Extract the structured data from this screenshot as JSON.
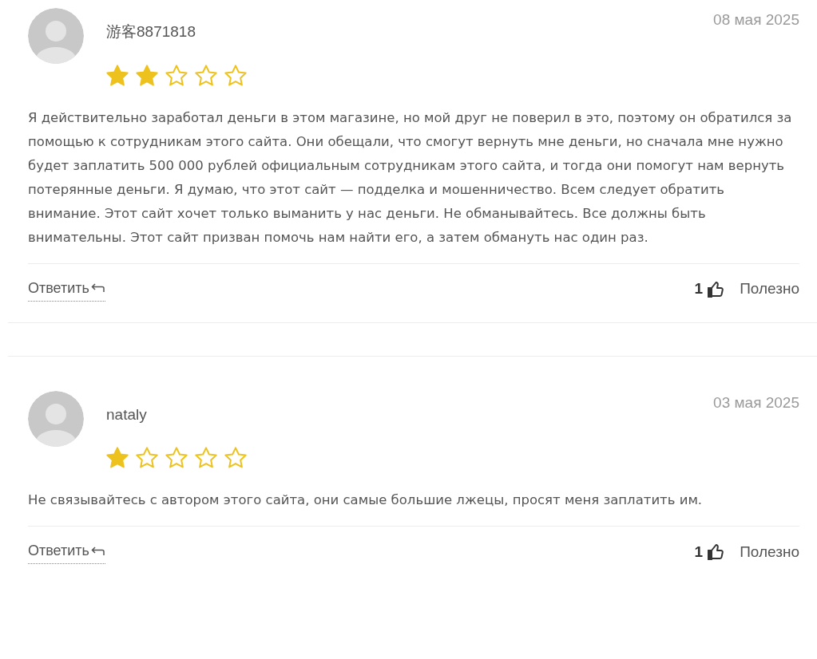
{
  "reviews": [
    {
      "author": "游客8871818",
      "date": "08 мая 2025",
      "stars": 2,
      "text": "Я действительно заработал деньги в этом магазине, но мой друг не поверил в это, поэтому он обратился за помощью к сотрудникам этого сайта. Они обещали, что смогут вернуть мне деньги, но сначала мне нужно будет заплатить 500 000 рублей официальным сотрудникам этого сайта, и тогда они помогут нам вернуть потерянные деньги. Я думаю, что этот сайт — подделка и мошенничество. Всем следует обратить внимание. Этот сайт хочет только выманить у нас деньги. Не обманывайтесь. Все должны быть внимательны. Этот сайт призван помочь нам найти его, а затем обмануть нас один раз.",
      "reply": "Ответить",
      "likes": "1",
      "helpful": "Полезно"
    },
    {
      "author": "nataly",
      "date": "03 мая 2025",
      "stars": 1,
      "text": "Не связывайтесь с автором этого сайта, они самые большие лжецы, просят меня заплатить им.",
      "reply": "Ответить",
      "likes": "1",
      "helpful": "Полезно"
    }
  ]
}
